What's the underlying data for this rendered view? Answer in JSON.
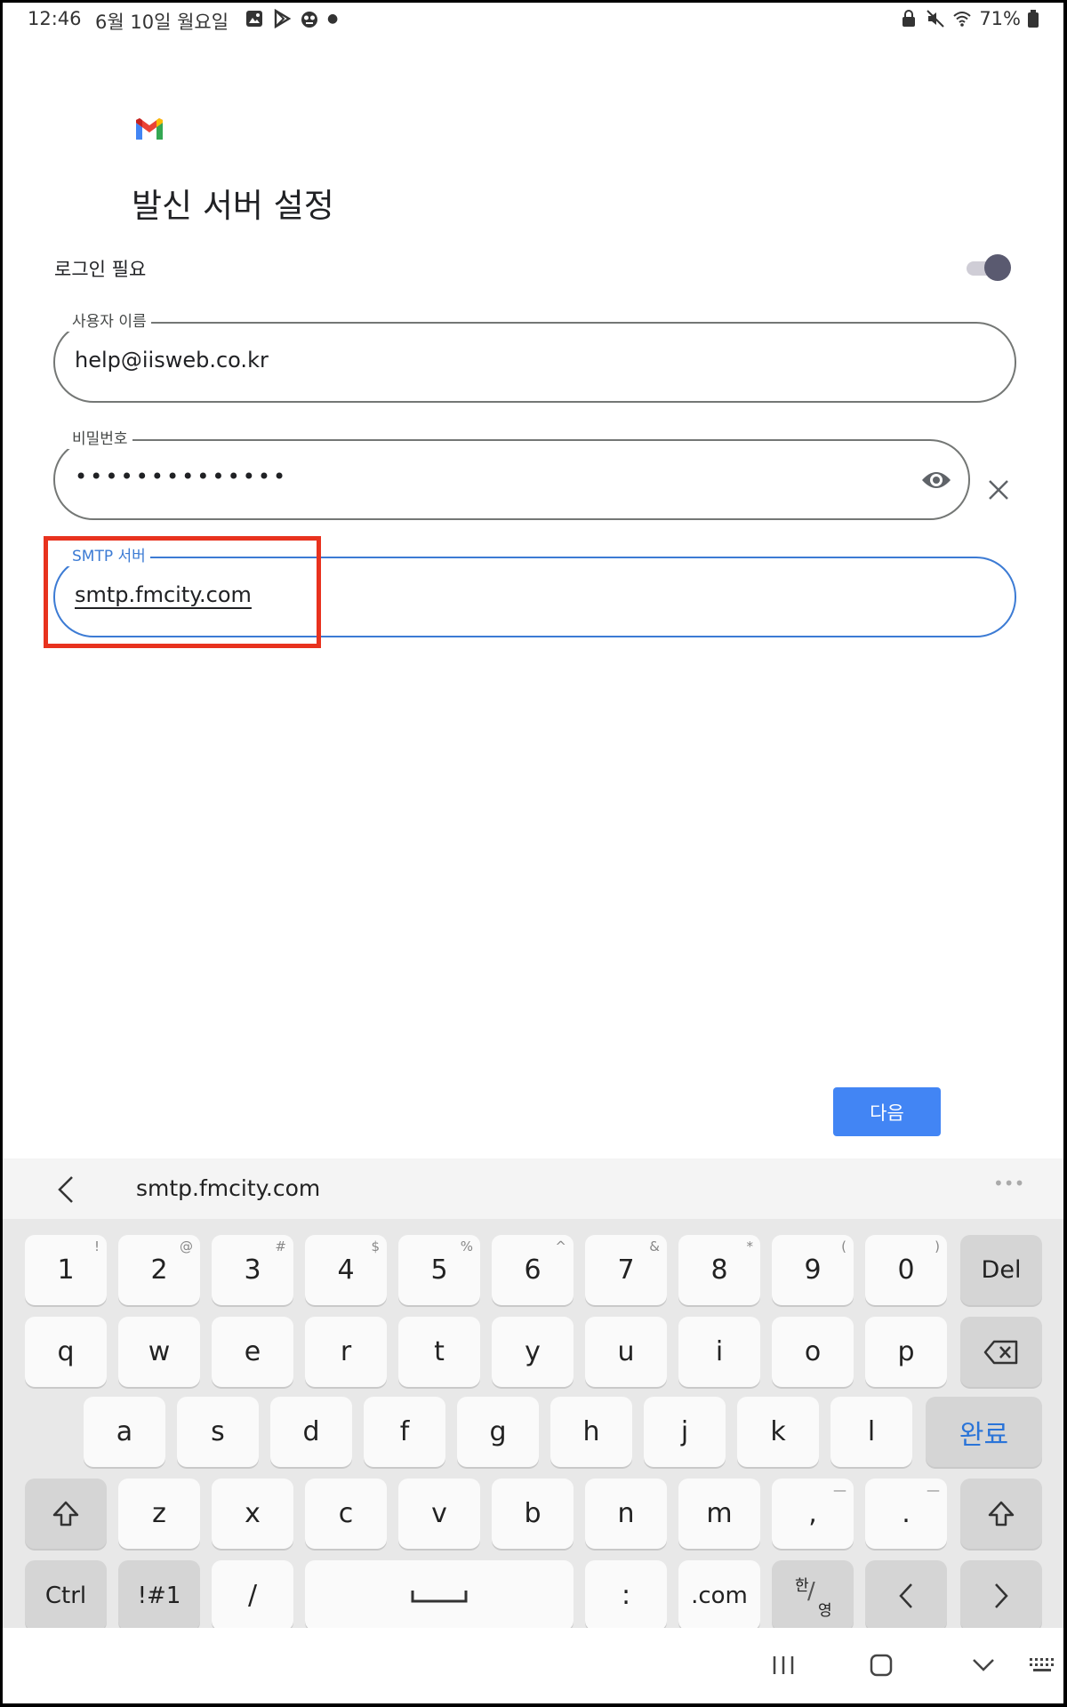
{
  "status_bar": {
    "time": "12:46",
    "date": "6월 10일 월요일",
    "battery": "71%"
  },
  "header": {
    "title": "발신 서버 설정"
  },
  "login_required": {
    "label": "로그인 필요",
    "enabled": true
  },
  "fields": {
    "username": {
      "label": "사용자 이름",
      "value": "help@iisweb.co.kr"
    },
    "password": {
      "label": "비밀번호",
      "value": "••••••••••••••"
    },
    "smtp": {
      "label": "SMTP 서버",
      "value": "smtp.fmcity.com"
    }
  },
  "next_button": "다음",
  "keyboard": {
    "suggestion": "smtp.fmcity.com",
    "more": "•••",
    "row1": [
      {
        "k": "1",
        "s": "!"
      },
      {
        "k": "2",
        "s": "@"
      },
      {
        "k": "3",
        "s": "#"
      },
      {
        "k": "4",
        "s": "$"
      },
      {
        "k": "5",
        "s": "%"
      },
      {
        "k": "6",
        "s": "^"
      },
      {
        "k": "7",
        "s": "&"
      },
      {
        "k": "8",
        "s": "*"
      },
      {
        "k": "9",
        "s": "("
      },
      {
        "k": "0",
        "s": ")"
      }
    ],
    "del": "Del",
    "row2": [
      "q",
      "w",
      "e",
      "r",
      "t",
      "y",
      "u",
      "i",
      "o",
      "p"
    ],
    "row3": [
      "a",
      "s",
      "d",
      "f",
      "g",
      "h",
      "j",
      "k",
      "l"
    ],
    "done": "완료",
    "row4": [
      "z",
      "x",
      "c",
      "v",
      "b",
      "n",
      "m"
    ],
    "comma": {
      "k": ",",
      "s": "—"
    },
    "period": {
      "k": ".",
      "s": "—"
    },
    "ctrl": "Ctrl",
    "symbols": "!#1",
    "slash": "/",
    "colon": ":",
    "dotcom": ".com",
    "lang_top": "한",
    "lang_bottom": "영"
  },
  "colors": {
    "accent": "#3c7bd4",
    "button": "#4285f4",
    "highlight": "#e8321e"
  }
}
